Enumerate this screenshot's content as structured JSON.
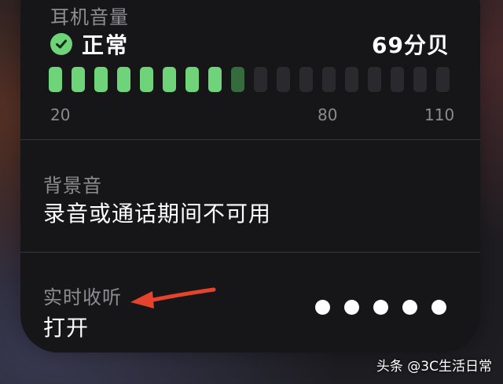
{
  "headphone": {
    "title": "耳机音量",
    "status": "正常",
    "level": "69分贝",
    "meter_lit_bars": 9,
    "meter_total_bars": 18,
    "ticks": [
      "20",
      "80",
      "110"
    ]
  },
  "background_sounds": {
    "title": "背景音",
    "value": "录音或通话期间不可用"
  },
  "live_listen": {
    "title": "实时收听",
    "value": "打开",
    "dot_count": 5
  },
  "watermark": "头条 @3C生活日常",
  "colors": {
    "accent_green": "#6fd37a",
    "meter_dim_green": "#356b3d",
    "meter_off": "#2a2a2e",
    "arrow_red": "#e5432c"
  }
}
